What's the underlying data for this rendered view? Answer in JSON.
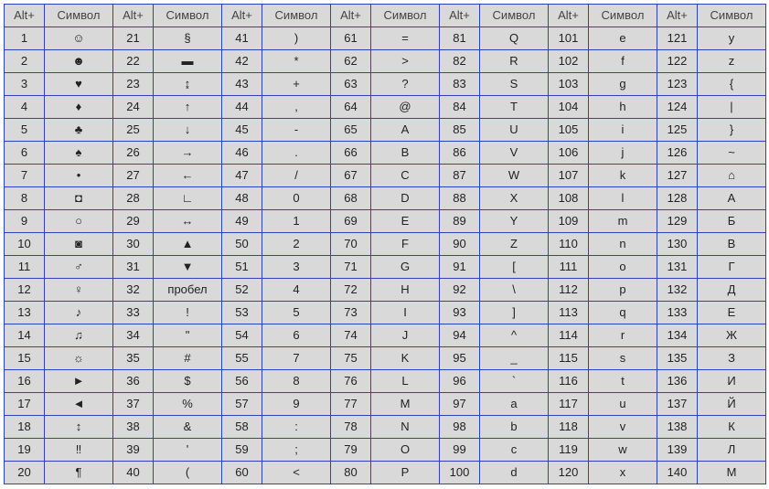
{
  "headers": {
    "code": "Alt+",
    "symbol": "Символ"
  },
  "columns": [
    [
      {
        "c": "1",
        "s": "☺"
      },
      {
        "c": "2",
        "s": "☻"
      },
      {
        "c": "3",
        "s": "♥"
      },
      {
        "c": "4",
        "s": "♦"
      },
      {
        "c": "5",
        "s": "♣"
      },
      {
        "c": "6",
        "s": "♠"
      },
      {
        "c": "7",
        "s": "•"
      },
      {
        "c": "8",
        "s": "◘"
      },
      {
        "c": "9",
        "s": "○"
      },
      {
        "c": "10",
        "s": "◙"
      },
      {
        "c": "11",
        "s": "♂"
      },
      {
        "c": "12",
        "s": "♀"
      },
      {
        "c": "13",
        "s": "♪"
      },
      {
        "c": "14",
        "s": "♫"
      },
      {
        "c": "15",
        "s": "☼"
      },
      {
        "c": "16",
        "s": "►"
      },
      {
        "c": "17",
        "s": "◄"
      },
      {
        "c": "18",
        "s": "↕"
      },
      {
        "c": "19",
        "s": "‼"
      },
      {
        "c": "20",
        "s": "¶"
      }
    ],
    [
      {
        "c": "21",
        "s": "§"
      },
      {
        "c": "22",
        "s": "▬"
      },
      {
        "c": "23",
        "s": "↨"
      },
      {
        "c": "24",
        "s": "↑"
      },
      {
        "c": "25",
        "s": "↓"
      },
      {
        "c": "26",
        "s": "→"
      },
      {
        "c": "27",
        "s": "←"
      },
      {
        "c": "28",
        "s": "∟"
      },
      {
        "c": "29",
        "s": "↔"
      },
      {
        "c": "30",
        "s": "▲"
      },
      {
        "c": "31",
        "s": "▼"
      },
      {
        "c": "32",
        "s": "пробел"
      },
      {
        "c": "33",
        "s": "!"
      },
      {
        "c": "34",
        "s": "\""
      },
      {
        "c": "35",
        "s": "#"
      },
      {
        "c": "36",
        "s": "$"
      },
      {
        "c": "37",
        "s": "%"
      },
      {
        "c": "38",
        "s": "&"
      },
      {
        "c": "39",
        "s": "'"
      },
      {
        "c": "40",
        "s": "("
      }
    ],
    [
      {
        "c": "41",
        "s": ")"
      },
      {
        "c": "42",
        "s": "*"
      },
      {
        "c": "43",
        "s": "+"
      },
      {
        "c": "44",
        "s": ","
      },
      {
        "c": "45",
        "s": "-"
      },
      {
        "c": "46",
        "s": "."
      },
      {
        "c": "47",
        "s": "/"
      },
      {
        "c": "48",
        "s": "0"
      },
      {
        "c": "49",
        "s": "1"
      },
      {
        "c": "50",
        "s": "2"
      },
      {
        "c": "51",
        "s": "3"
      },
      {
        "c": "52",
        "s": "4"
      },
      {
        "c": "53",
        "s": "5"
      },
      {
        "c": "54",
        "s": "6"
      },
      {
        "c": "55",
        "s": "7"
      },
      {
        "c": "56",
        "s": "8"
      },
      {
        "c": "57",
        "s": "9"
      },
      {
        "c": "58",
        "s": ":"
      },
      {
        "c": "59",
        "s": ";"
      },
      {
        "c": "60",
        "s": "<"
      }
    ],
    [
      {
        "c": "61",
        "s": "="
      },
      {
        "c": "62",
        "s": ">"
      },
      {
        "c": "63",
        "s": "?"
      },
      {
        "c": "64",
        "s": "@"
      },
      {
        "c": "65",
        "s": "A"
      },
      {
        "c": "66",
        "s": "B"
      },
      {
        "c": "67",
        "s": "C"
      },
      {
        "c": "68",
        "s": "D"
      },
      {
        "c": "69",
        "s": "E"
      },
      {
        "c": "70",
        "s": "F"
      },
      {
        "c": "71",
        "s": "G"
      },
      {
        "c": "72",
        "s": "H"
      },
      {
        "c": "73",
        "s": "I"
      },
      {
        "c": "74",
        "s": "J"
      },
      {
        "c": "75",
        "s": "K"
      },
      {
        "c": "76",
        "s": "L"
      },
      {
        "c": "77",
        "s": "M"
      },
      {
        "c": "78",
        "s": "N"
      },
      {
        "c": "79",
        "s": "O"
      },
      {
        "c": "80",
        "s": "P"
      }
    ],
    [
      {
        "c": "81",
        "s": "Q"
      },
      {
        "c": "82",
        "s": "R"
      },
      {
        "c": "83",
        "s": "S"
      },
      {
        "c": "84",
        "s": "T"
      },
      {
        "c": "85",
        "s": "U"
      },
      {
        "c": "86",
        "s": "V"
      },
      {
        "c": "87",
        "s": "W"
      },
      {
        "c": "88",
        "s": "X"
      },
      {
        "c": "89",
        "s": "Y"
      },
      {
        "c": "90",
        "s": "Z"
      },
      {
        "c": "91",
        "s": "["
      },
      {
        "c": "92",
        "s": "\\"
      },
      {
        "c": "93",
        "s": "]"
      },
      {
        "c": "94",
        "s": "^"
      },
      {
        "c": "95",
        "s": "_"
      },
      {
        "c": "96",
        "s": "`"
      },
      {
        "c": "97",
        "s": "a"
      },
      {
        "c": "98",
        "s": "b"
      },
      {
        "c": "99",
        "s": "c"
      },
      {
        "c": "100",
        "s": "d"
      }
    ],
    [
      {
        "c": "101",
        "s": "e"
      },
      {
        "c": "102",
        "s": "f"
      },
      {
        "c": "103",
        "s": "g"
      },
      {
        "c": "104",
        "s": "h"
      },
      {
        "c": "105",
        "s": "i"
      },
      {
        "c": "106",
        "s": "j"
      },
      {
        "c": "107",
        "s": "k"
      },
      {
        "c": "108",
        "s": "l"
      },
      {
        "c": "109",
        "s": "m"
      },
      {
        "c": "110",
        "s": "n"
      },
      {
        "c": "111",
        "s": "o"
      },
      {
        "c": "112",
        "s": "p"
      },
      {
        "c": "113",
        "s": "q"
      },
      {
        "c": "114",
        "s": "r"
      },
      {
        "c": "115",
        "s": "s"
      },
      {
        "c": "116",
        "s": "t"
      },
      {
        "c": "117",
        "s": "u"
      },
      {
        "c": "118",
        "s": "v"
      },
      {
        "c": "119",
        "s": "w"
      },
      {
        "c": "120",
        "s": "x"
      }
    ],
    [
      {
        "c": "121",
        "s": "y"
      },
      {
        "c": "122",
        "s": "z"
      },
      {
        "c": "123",
        "s": "{"
      },
      {
        "c": "124",
        "s": "|"
      },
      {
        "c": "125",
        "s": "}"
      },
      {
        "c": "126",
        "s": "~"
      },
      {
        "c": "127",
        "s": "⌂"
      },
      {
        "c": "128",
        "s": "А"
      },
      {
        "c": "129",
        "s": "Б"
      },
      {
        "c": "130",
        "s": "В"
      },
      {
        "c": "131",
        "s": "Г"
      },
      {
        "c": "132",
        "s": "Д"
      },
      {
        "c": "133",
        "s": "Е"
      },
      {
        "c": "134",
        "s": "Ж"
      },
      {
        "c": "135",
        "s": "З"
      },
      {
        "c": "136",
        "s": "И"
      },
      {
        "c": "137",
        "s": "Й"
      },
      {
        "c": "138",
        "s": "К"
      },
      {
        "c": "139",
        "s": "Л"
      },
      {
        "c": "140",
        "s": "М"
      }
    ]
  ]
}
